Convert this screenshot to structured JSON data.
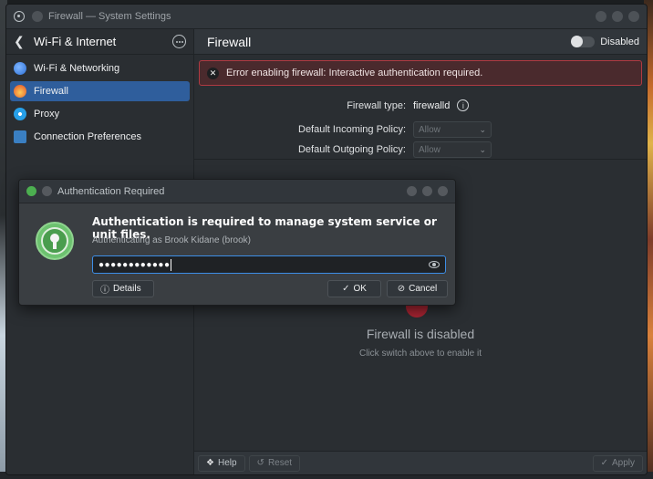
{
  "window": {
    "title": "Firewall — System Settings"
  },
  "sidebar": {
    "title": "Wi-Fi & Internet",
    "items": [
      {
        "label": "Wi-Fi & Networking",
        "icon": "wifi-icon"
      },
      {
        "label": "Firewall",
        "icon": "firewall-icon",
        "active": true
      },
      {
        "label": "Proxy",
        "icon": "proxy-icon"
      },
      {
        "label": "Connection Preferences",
        "icon": "connection-icon"
      }
    ]
  },
  "main": {
    "title": "Firewall",
    "toggle_label": "Disabled",
    "error": "Error enabling firewall: Interactive authentication required.",
    "firewall_type_label": "Firewall type:",
    "firewall_type_value": "firewalld",
    "incoming_label": "Default Incoming Policy:",
    "incoming_value": "Allow",
    "outgoing_label": "Default Outgoing Policy:",
    "outgoing_value": "Allow",
    "disabled_title": "Firewall is disabled",
    "disabled_sub": "Click switch above to enable it"
  },
  "bottom": {
    "help": "Help",
    "reset": "Reset",
    "apply": "Apply"
  },
  "dialog": {
    "title": "Authentication Required",
    "heading": "Authentication is required to manage system service or unit files.",
    "sub": "Authenticating as Brook Kidane (brook)",
    "password_mask": "●●●●●●●●●●●●",
    "details": "Details",
    "ok": "OK",
    "cancel": "Cancel"
  },
  "colors": {
    "accent": "#3d8ee6",
    "error_border": "#b03a42",
    "active_item": "#2f5e9c"
  }
}
